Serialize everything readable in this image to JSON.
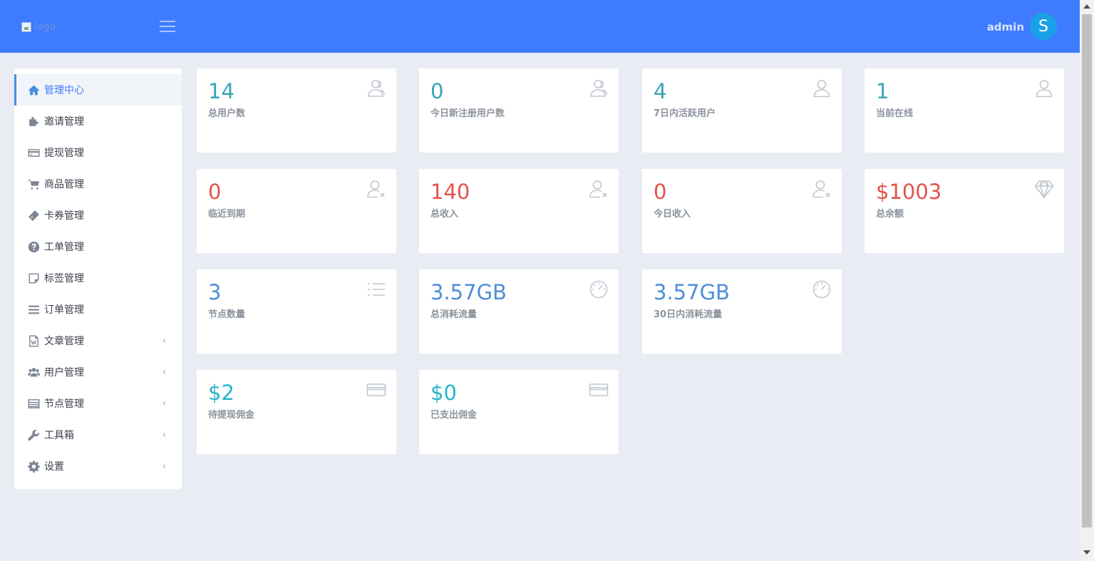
{
  "header": {
    "logo_alt": "logo",
    "user_name": "admin",
    "avatar_letter": "S",
    "bg_color": "#3f7bff"
  },
  "sidebar": {
    "items": [
      {
        "label": "管理中心",
        "icon": "home-icon",
        "active": true
      },
      {
        "label": "邀请管理",
        "icon": "puzzle-icon"
      },
      {
        "label": "提现管理",
        "icon": "credit-card-icon"
      },
      {
        "label": "商品管理",
        "icon": "cart-icon"
      },
      {
        "label": "卡券管理",
        "icon": "ticket-icon"
      },
      {
        "label": "工单管理",
        "icon": "question-icon"
      },
      {
        "label": "标签管理",
        "icon": "sticky-note-icon"
      },
      {
        "label": "订单管理",
        "icon": "list-icon"
      },
      {
        "label": "文章管理",
        "icon": "word-file-icon",
        "has_children": true
      },
      {
        "label": "用户管理",
        "icon": "users-icon",
        "has_children": true
      },
      {
        "label": "节点管理",
        "icon": "server-list-icon",
        "has_children": true
      },
      {
        "label": "工具箱",
        "icon": "wrench-icon",
        "has_children": true
      },
      {
        "label": "设置",
        "icon": "gear-icon",
        "has_children": true
      }
    ],
    "arrow_glyph": "‹"
  },
  "stats": {
    "total_users": {
      "value": "14",
      "label": "总用户数",
      "icon": "users-outline-icon"
    },
    "today_new_users": {
      "value": "0",
      "label": "今日新注册用户数",
      "icon": "users-outline-icon"
    },
    "active_7d": {
      "value": "4",
      "label": "7日内活跃用户",
      "icon": "user-outline-icon"
    },
    "online_now": {
      "value": "1",
      "label": "当前在线",
      "icon": "user-outline-icon"
    },
    "expiring_soon": {
      "value": "0",
      "label": "临近到期",
      "icon": "user-remove-icon"
    },
    "total_income": {
      "value": "140",
      "label": "总收入",
      "icon": "user-remove-icon"
    },
    "today_income": {
      "value": "0",
      "label": "今日收入",
      "icon": "user-remove-icon"
    },
    "total_balance": {
      "value": "$1003",
      "label": "总余额",
      "icon": "diamond-icon"
    },
    "node_count": {
      "value": "3",
      "label": "节点数量",
      "icon": "list-icon"
    },
    "total_traffic": {
      "value": "3.57GB",
      "label": "总消耗流量",
      "icon": "speedometer-icon"
    },
    "traffic_30d": {
      "value": "3.57GB",
      "label": "30日内消耗流量",
      "icon": "speedometer-icon"
    },
    "pending_commission": {
      "value": "$2",
      "label": "待提现佣金",
      "icon": "credit-card-icon"
    },
    "paid_commission": {
      "value": "$0",
      "label": "已支出佣金",
      "icon": "credit-card-icon"
    }
  },
  "colors": {
    "teal": "#37a4b8",
    "red": "#e2534b",
    "blue": "#4f8dd8",
    "cyan": "#29b6c9"
  }
}
